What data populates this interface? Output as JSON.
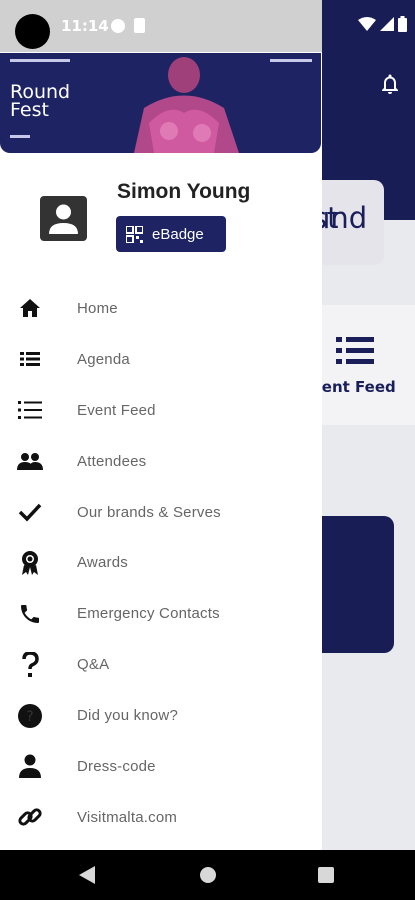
{
  "status_bar": {
    "time": "11:14"
  },
  "banner": {
    "title_line1": "Round",
    "title_line2": "Fest"
  },
  "profile": {
    "name": "Simon Young",
    "ebadge_label": "eBadge"
  },
  "menu": [
    {
      "label": "Home",
      "icon": "home-icon"
    },
    {
      "label": "Agenda",
      "icon": "agenda-icon"
    },
    {
      "label": "Event Feed",
      "icon": "list-icon"
    },
    {
      "label": "Attendees",
      "icon": "people-icon"
    },
    {
      "label": "Our brands & Serves",
      "icon": "check-icon"
    },
    {
      "label": "Awards",
      "icon": "award-icon"
    },
    {
      "label": "Emergency Contacts",
      "icon": "phone-icon"
    },
    {
      "label": "Q&A",
      "icon": "question-icon"
    },
    {
      "label": "Did you know?",
      "icon": "info-circle-icon"
    },
    {
      "label": "Dress-code",
      "icon": "person-icon"
    },
    {
      "label": "Visitmalta.com",
      "icon": "link-icon"
    }
  ],
  "background_app": {
    "logo_text_line1": "und",
    "logo_text_line2": "st",
    "tile_label": "vent Feed"
  },
  "colors": {
    "brand_navy": "#1e2463",
    "drawer_bg": "#ffffff",
    "label_gray": "#666666"
  }
}
